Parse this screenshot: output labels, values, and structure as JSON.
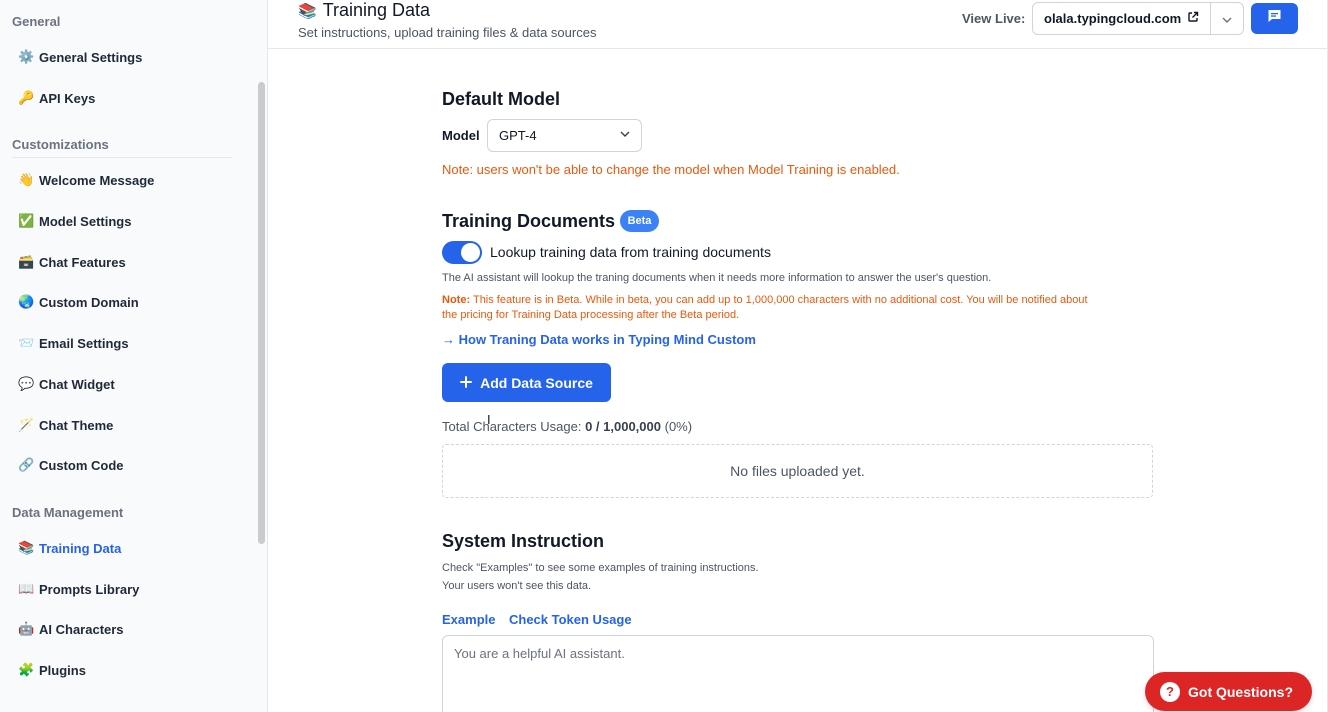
{
  "sidebar": {
    "sections": {
      "general": "General",
      "customizations": "Customizations",
      "data_management": "Data Management"
    },
    "items": [
      {
        "emoji": "⚙️",
        "label": "General Settings"
      },
      {
        "emoji": "🔑",
        "label": "API Keys"
      },
      {
        "emoji": "👋",
        "label": "Welcome Message"
      },
      {
        "emoji": "✅",
        "label": "Model Settings"
      },
      {
        "emoji": "🗃️",
        "label": "Chat Features"
      },
      {
        "emoji": "🌏",
        "label": "Custom Domain"
      },
      {
        "emoji": "📨",
        "label": "Email Settings"
      },
      {
        "emoji": "💬",
        "label": "Chat Widget"
      },
      {
        "emoji": "🪄",
        "label": "Chat Theme"
      },
      {
        "emoji": "🔗",
        "label": "Custom Code"
      },
      {
        "emoji": "📚",
        "label": "Training Data"
      },
      {
        "emoji": "📖",
        "label": "Prompts Library"
      },
      {
        "emoji": "🤖",
        "label": "AI Characters"
      },
      {
        "emoji": "🧩",
        "label": "Plugins"
      }
    ],
    "active_item": "Training Data"
  },
  "header": {
    "title_emoji": "📚",
    "title": "Training Data",
    "subtitle": "Set instructions, upload training files & data sources",
    "view_live_label": "View Live:",
    "domain": "olala.typingcloud.com"
  },
  "default_model": {
    "heading": "Default Model",
    "model_label": "Model",
    "model_value": "GPT-4",
    "note": "Note: users won't be able to change the model when Model Training is enabled."
  },
  "training_documents": {
    "heading": "Training Documents",
    "badge": "Beta",
    "toggle_on": true,
    "toggle_label": "Lookup training data from training documents",
    "description": "The AI assistant will lookup the traning documents when it needs more information to answer the user's question.",
    "note_prefix": "Note:",
    "note_line1": "This feature is in Beta. While in beta, you can add up to 1,000,000 characters with no additional cost. You will be notified about",
    "note_line2": "the pricing for Training Data processing after the Beta period.",
    "how_link": "→ How Traning Data works in Typing Mind Custom",
    "add_button": "Add Data Source",
    "usage_label": "Total Characters Usage:",
    "usage_value": "0 / 1,000,000",
    "usage_percent": "(0%)",
    "empty_text": "No files uploaded yet."
  },
  "system_instruction": {
    "heading": "System Instruction",
    "help_line1": "Check \"Examples\" to see some examples of training instructions.",
    "help_line2": "Your users won't see this data.",
    "example_link": "Example",
    "token_link": "Check Token Usage",
    "placeholder": "You are a helpful AI assistant."
  },
  "support": {
    "label": "Got Questions?"
  },
  "colors": {
    "accent": "#2563eb",
    "warning": "#ea580c",
    "support": "#dc2626"
  }
}
